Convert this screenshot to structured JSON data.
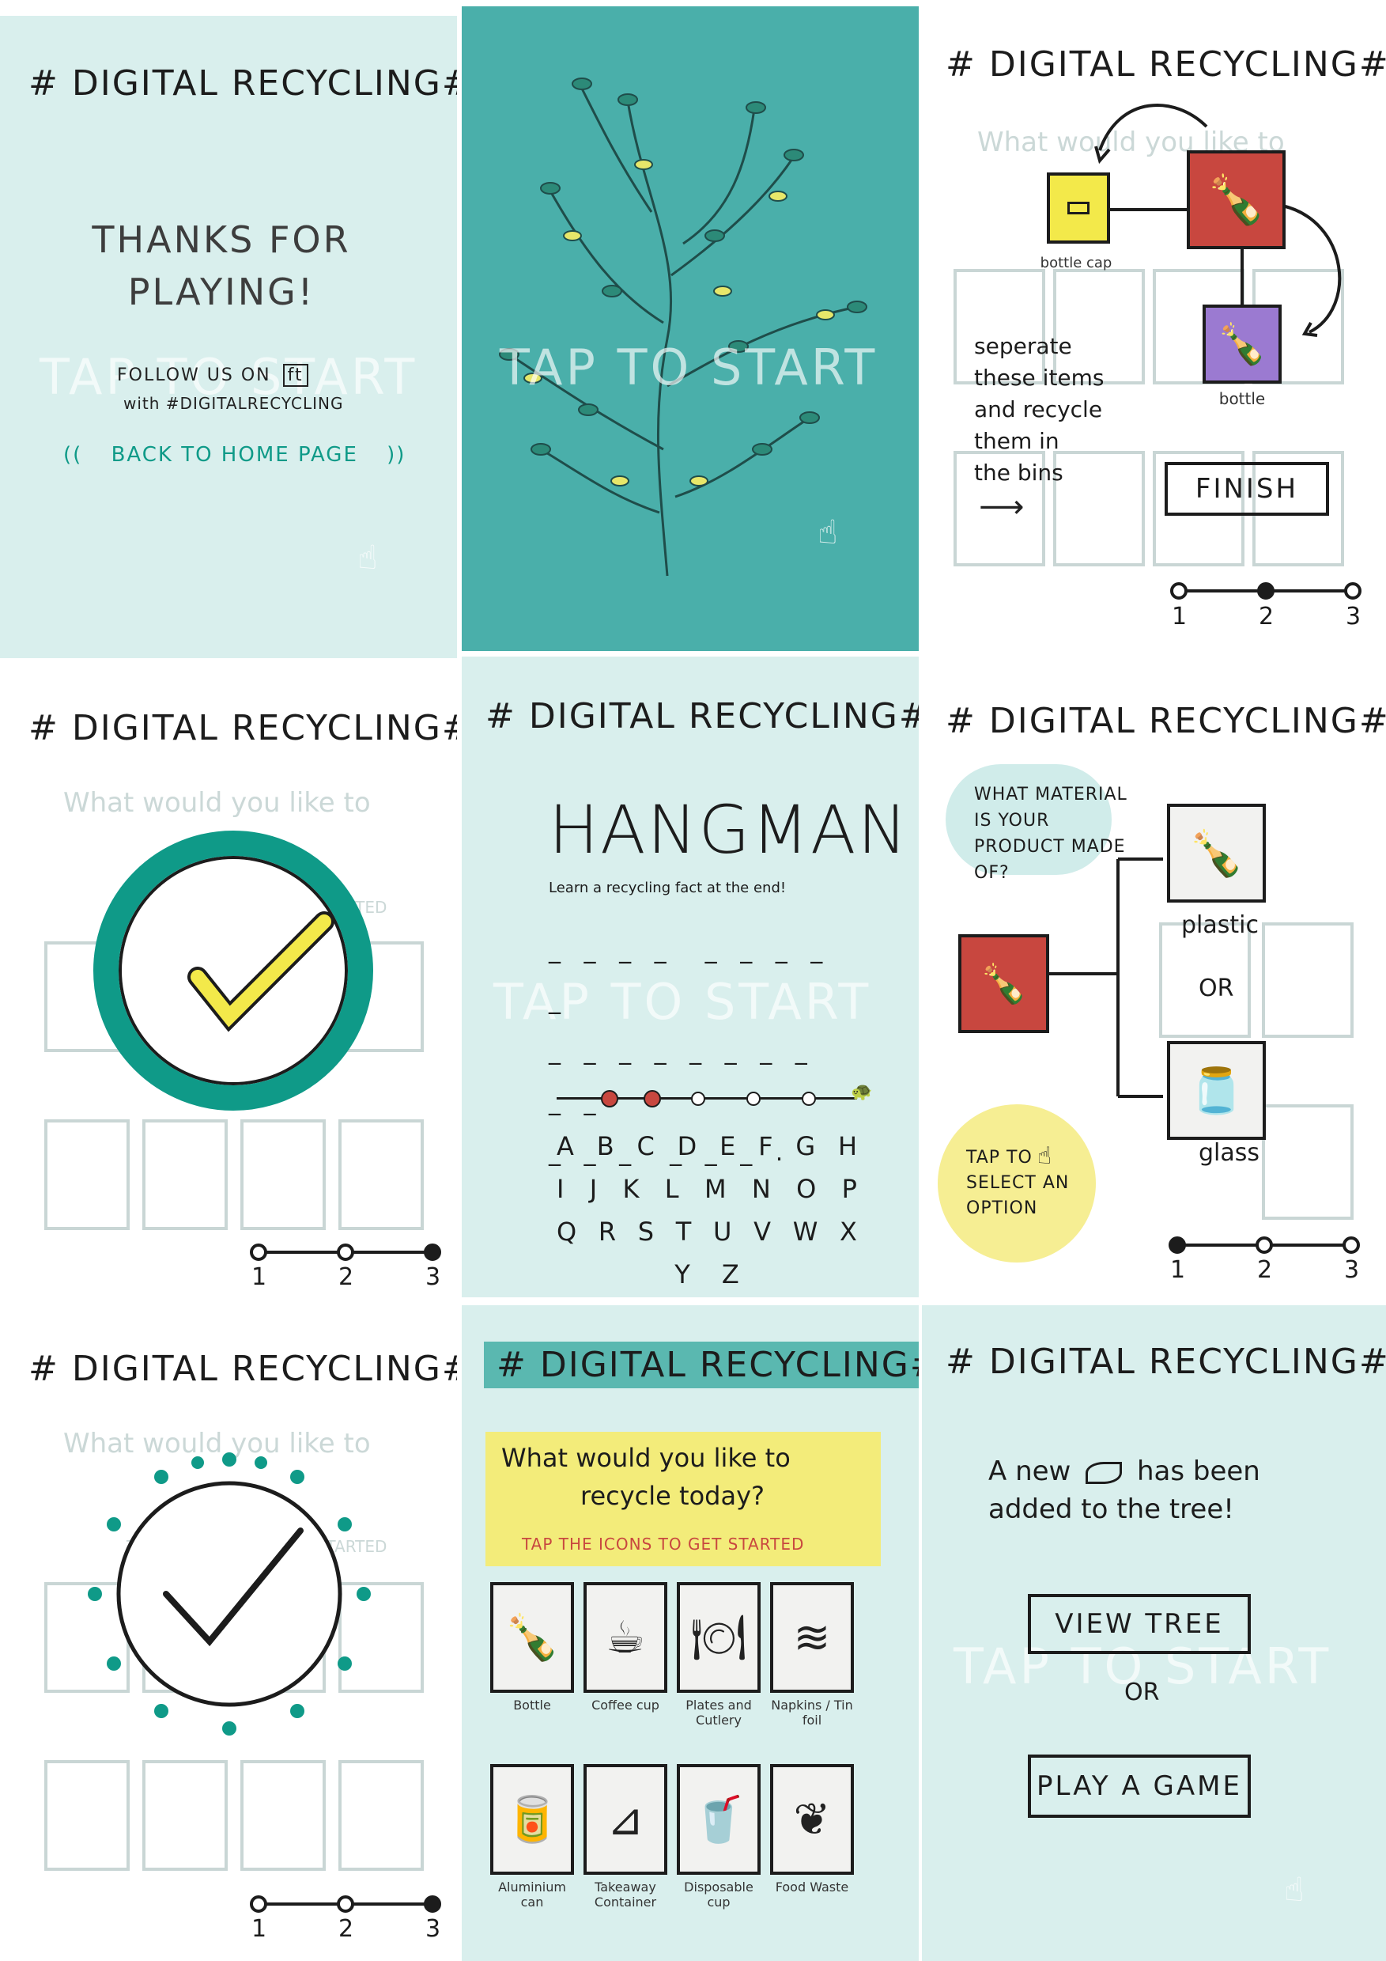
{
  "app_title": "# DIGITAL RECYCLING#",
  "tap_to_start": "TAP TO START",
  "thanks": {
    "heading": "THANKS FOR PLAYING!",
    "follow_prefix": "FOLLOW US ON",
    "follow_brand": "ft",
    "follow_with": "with #DIGITALRECYCLING",
    "back_link": "BACK TO HOME PAGE"
  },
  "separate": {
    "bottle_cap": "bottle cap",
    "bottle": "bottle",
    "instruction": [
      "seperate",
      "these items",
      "and recycle",
      "them in",
      "the bins"
    ],
    "finish": "FINISH"
  },
  "progress_labels": [
    "1",
    "2",
    "3"
  ],
  "hangman": {
    "title": "HANGMAN",
    "subtitle": "Learn a recycling fact at the end!",
    "letters": [
      [
        "A",
        "B",
        "C",
        "D",
        "E",
        "F",
        "G",
        "H"
      ],
      [
        "I",
        "J",
        "K",
        "L",
        "M",
        "N",
        "O",
        "P"
      ],
      [
        "Q",
        "R",
        "S",
        "T",
        "U",
        "V",
        "W",
        "X"
      ],
      [
        "Y",
        "Z"
      ]
    ]
  },
  "material": {
    "question": "WHAT MATERIAL IS YOUR PRODUCT MADE OF?",
    "plastic": "plastic",
    "or": "OR",
    "glass": "glass",
    "tap_hint": "TAP TO SELECT AN OPTION"
  },
  "home": {
    "question_line1": "What would you like to",
    "question_line2": "recycle today?",
    "tap_line": "TAP THE ICONS TO GET STARTED",
    "items": [
      {
        "label": "Bottle",
        "icon": "bottle-icon",
        "glyph": "🍾"
      },
      {
        "label": "Coffee cup",
        "icon": "coffee-cup-icon",
        "glyph": "☕"
      },
      {
        "label": "Plates and Cutlery",
        "icon": "plate-cutlery-icon",
        "glyph": "🍽"
      },
      {
        "label": "Napkins / Tin foil",
        "icon": "napkin-icon",
        "glyph": "≋"
      },
      {
        "label": "Aluminium can",
        "icon": "can-icon",
        "glyph": "🥫"
      },
      {
        "label": "Takeaway Container",
        "icon": "container-icon",
        "glyph": "⊿"
      },
      {
        "label": "Disposable cup",
        "icon": "disposable-cup-icon",
        "glyph": "🥤"
      },
      {
        "label": "Food Waste",
        "icon": "food-waste-icon",
        "glyph": "❦"
      }
    ]
  },
  "leaf_added": {
    "line1_a": "A new",
    "line1_b": "has been",
    "line2": "added to the tree!",
    "view_tree": "VIEW TREE",
    "or": "OR",
    "play": "PLAY A GAME"
  },
  "colors": {
    "mint": "#d9efed",
    "teal": "#4aafaa",
    "accent_teal": "#0f9a88",
    "yellow": "#f3e94a",
    "red": "#c8473f",
    "purple": "#9b7ad1"
  }
}
